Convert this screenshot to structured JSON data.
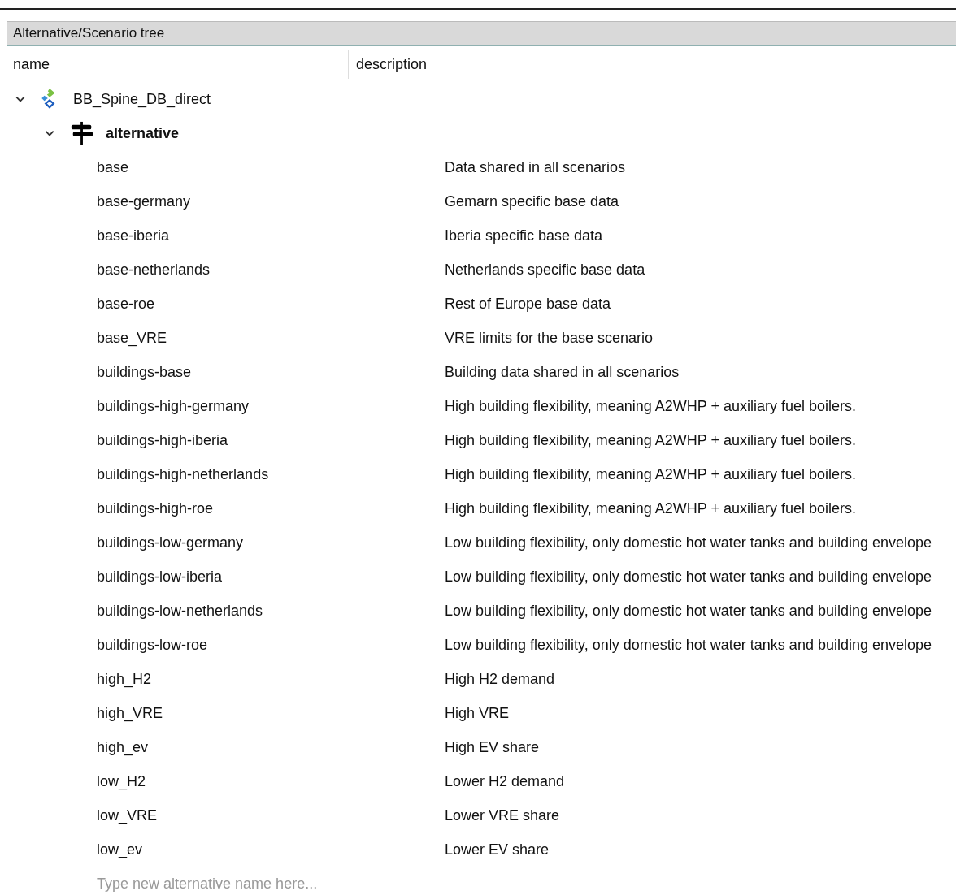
{
  "panel": {
    "title": "Alternative/Scenario tree"
  },
  "table": {
    "columns": [
      "name",
      "description"
    ],
    "tree": [
      {
        "name": "BB_Spine_DB_direct",
        "kind": "database",
        "expanded": true,
        "children": [
          {
            "name": "alternative",
            "kind": "group",
            "expanded": true,
            "children": [
              {
                "name": "base",
                "description": "Data shared in all scenarios"
              },
              {
                "name": "base-germany",
                "description": "Gemarn specific base data"
              },
              {
                "name": "base-iberia",
                "description": "Iberia specific base data"
              },
              {
                "name": "base-netherlands",
                "description": "Netherlands specific base data"
              },
              {
                "name": "base-roe",
                "description": "Rest of Europe base data"
              },
              {
                "name": "base_VRE",
                "description": "VRE limits for the base scenario"
              },
              {
                "name": "buildings-base",
                "description": "Building data shared in all scenarios"
              },
              {
                "name": "buildings-high-germany",
                "description": "High building flexibility, meaning A2WHP + auxiliary fuel boilers."
              },
              {
                "name": "buildings-high-iberia",
                "description": "High building flexibility, meaning A2WHP + auxiliary fuel boilers."
              },
              {
                "name": "buildings-high-netherlands",
                "description": "High building flexibility, meaning A2WHP + auxiliary fuel boilers."
              },
              {
                "name": "buildings-high-roe",
                "description": "High building flexibility, meaning A2WHP + auxiliary fuel boilers."
              },
              {
                "name": "buildings-low-germany",
                "description": "Low building flexibility, only domestic hot water tanks and building envelope"
              },
              {
                "name": "buildings-low-iberia",
                "description": "Low building flexibility, only domestic hot water tanks and building envelope"
              },
              {
                "name": "buildings-low-netherlands",
                "description": "Low building flexibility, only domestic hot water tanks and building envelope"
              },
              {
                "name": "buildings-low-roe",
                "description": "Low building flexibility, only domestic hot water tanks and building envelope"
              },
              {
                "name": "high_H2",
                "description": "High H2 demand"
              },
              {
                "name": "high_VRE",
                "description": "High VRE"
              },
              {
                "name": "high_ev",
                "description": "High EV share"
              },
              {
                "name": "low_H2",
                "description": "Lower H2 demand"
              },
              {
                "name": "low_VRE",
                "description": "Lower VRE share"
              },
              {
                "name": "low_ev",
                "description": "Lower EV share"
              }
            ],
            "placeholder": "Type new alternative name here..."
          }
        ]
      }
    ]
  }
}
